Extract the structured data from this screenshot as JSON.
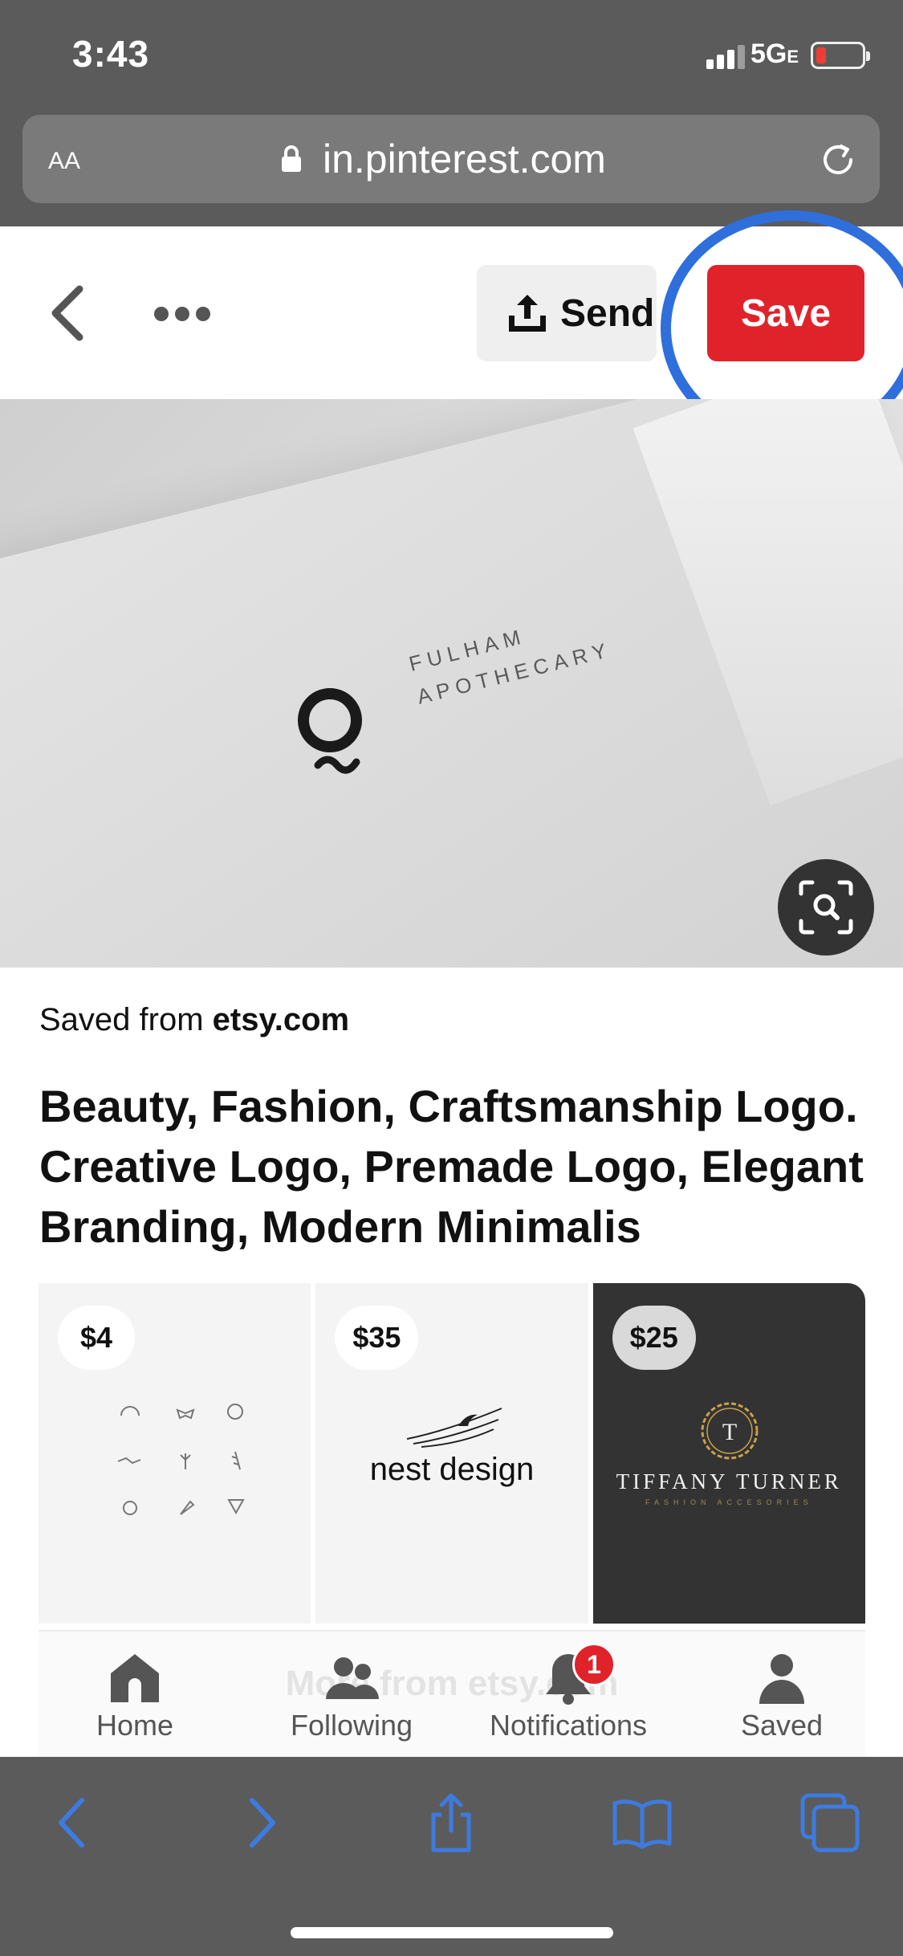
{
  "status_bar": {
    "time": "3:43",
    "network": "5G",
    "network_suffix": "E",
    "battery_color": "#ff3b30"
  },
  "browser": {
    "text_size_button": "AA",
    "url": "in.pinterest.com",
    "lock_icon": "lock-icon",
    "reload_icon": "reload-icon"
  },
  "pin_header": {
    "back_icon": "chevron-left-icon",
    "more_icon": "ellipsis-icon",
    "send_label": "Send",
    "save_label": "Save",
    "save_color": "#e0232b",
    "highlight_color": "#2f6fdc"
  },
  "pin_image": {
    "brand_line_1": "FULHAM",
    "brand_line_2": "APOTHECARY",
    "lens_icon": "visual-search-icon"
  },
  "pin_details": {
    "saved_from_prefix": "Saved from ",
    "saved_from_source": "etsy.com",
    "title": "Beauty, Fashion, Craftsmanship Logo. Creative Logo, Premade Logo, Elegant Branding, Modern Minimalis"
  },
  "products": [
    {
      "price": "$4"
    },
    {
      "price": "$35",
      "brand": "nest design"
    },
    {
      "price": "$25",
      "monogram": "T",
      "brand": "TIFFANY TURNER",
      "tagline": "FASHION ACCESORIES"
    }
  ],
  "more_from": "More from etsy.com",
  "tabs": [
    {
      "label": "Home",
      "icon": "home-icon"
    },
    {
      "label": "Following",
      "icon": "people-icon"
    },
    {
      "label": "Notifications",
      "icon": "bell-icon",
      "badge": "1"
    },
    {
      "label": "Saved",
      "icon": "person-icon"
    }
  ],
  "toolbar": {
    "back_icon": "back-arrow-icon",
    "forward_icon": "forward-arrow-icon",
    "share_icon": "share-icon",
    "bookmarks_icon": "book-icon",
    "tabs_icon": "tabs-icon",
    "accent": "#3d7be0"
  }
}
